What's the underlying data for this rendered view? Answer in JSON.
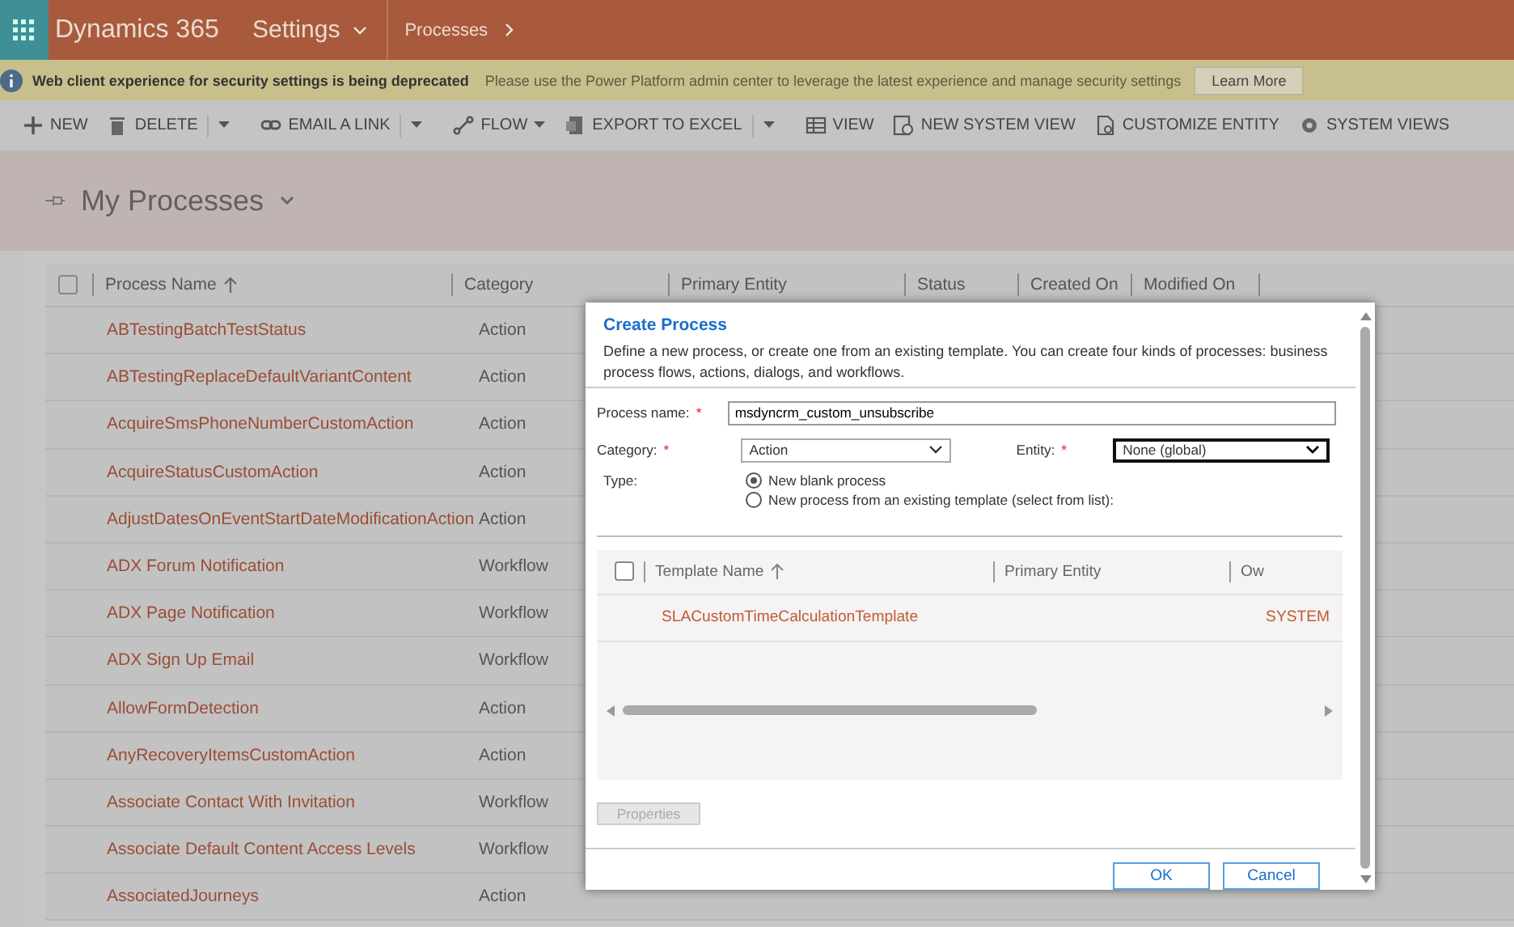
{
  "app_bar": {
    "product": "Dynamics 365",
    "area": "Settings",
    "breadcrumb": "Processes"
  },
  "notice": {
    "title": "Web client experience for security settings is being deprecated",
    "message": "Please use the Power Platform admin center to leverage the latest experience and manage security settings",
    "button": "Learn More"
  },
  "toolbar": [
    {
      "label": "NEW",
      "kind": "plus"
    },
    {
      "label": "DELETE",
      "kind": "trash",
      "split_menu": true
    },
    {
      "label": "EMAIL A LINK",
      "kind": "link",
      "split_menu": true
    },
    {
      "label": "FLOW",
      "kind": "flow",
      "dropdown": true
    },
    {
      "label": "EXPORT TO EXCEL",
      "kind": "excel",
      "split_menu": true
    },
    {
      "label": "VIEW",
      "kind": "view"
    },
    {
      "label": "NEW SYSTEM VIEW",
      "kind": "newview"
    },
    {
      "label": "CUSTOMIZE ENTITY",
      "kind": "customize"
    },
    {
      "label": "SYSTEM VIEWS",
      "kind": "gear"
    }
  ],
  "view": {
    "title": "My Processes"
  },
  "grid": {
    "select_all_checked": false,
    "columns": [
      {
        "label": "Process Name",
        "sorted": true
      },
      {
        "label": "Category",
        "sorted": false
      },
      {
        "label": "Primary Entity",
        "sorted": false
      },
      {
        "label": "Status",
        "sorted": false
      },
      {
        "label": "Created On",
        "sorted": false
      },
      {
        "label": "Modified On",
        "sorted": false
      }
    ],
    "rows": [
      {
        "name": "ABTestingBatchTestStatus",
        "category": "Action"
      },
      {
        "name": "ABTestingReplaceDefaultVariantContent",
        "category": "Action"
      },
      {
        "name": "AcquireSmsPhoneNumberCustomAction",
        "category": "Action"
      },
      {
        "name": "AcquireStatusCustomAction",
        "category": "Action"
      },
      {
        "name": "AdjustDatesOnEventStartDateModificationAction",
        "category": "Action"
      },
      {
        "name": "ADX Forum Notification",
        "category": "Workflow"
      },
      {
        "name": "ADX Page Notification",
        "category": "Workflow"
      },
      {
        "name": "ADX Sign Up Email",
        "category": "Workflow"
      },
      {
        "name": "AllowFormDetection",
        "category": "Action"
      },
      {
        "name": "AnyRecoveryItemsCustomAction",
        "category": "Action"
      },
      {
        "name": "Associate Contact With Invitation",
        "category": "Workflow"
      },
      {
        "name": "Associate Default Content Access Levels",
        "category": "Workflow"
      },
      {
        "name": "AssociatedJourneys",
        "category": "Action"
      }
    ]
  },
  "dialog": {
    "title": "Create Process",
    "description": "Define a new process, or create one from an existing template. You can create four kinds of processes: business process flows, actions, dialogs, and workflows.",
    "process_name": {
      "label": "Process name:",
      "required": "*",
      "value": "msdyncrm_custom_unsubscribe"
    },
    "category": {
      "label": "Category:",
      "required": "*",
      "value": "Action"
    },
    "entity": {
      "label": "Entity:",
      "required": "*",
      "value": "None (global)"
    },
    "type": {
      "label": "Type:",
      "options": [
        {
          "label": "New blank process",
          "selected": true
        },
        {
          "label": "New process from an existing template (select from list):",
          "selected": false
        }
      ]
    },
    "templates": {
      "select_all_checked": false,
      "columns": [
        {
          "label": "Template Name",
          "sorted": true
        },
        {
          "label": "Primary Entity",
          "sorted": false
        },
        {
          "label": "Ow",
          "sorted": false
        }
      ],
      "rows": [
        {
          "name": "SLACustomTimeCalculationTemplate",
          "owner": "SYSTEM"
        }
      ]
    },
    "properties_button": {
      "label": "Properties",
      "disabled": true
    },
    "ok": "OK",
    "cancel": "Cancel"
  }
}
